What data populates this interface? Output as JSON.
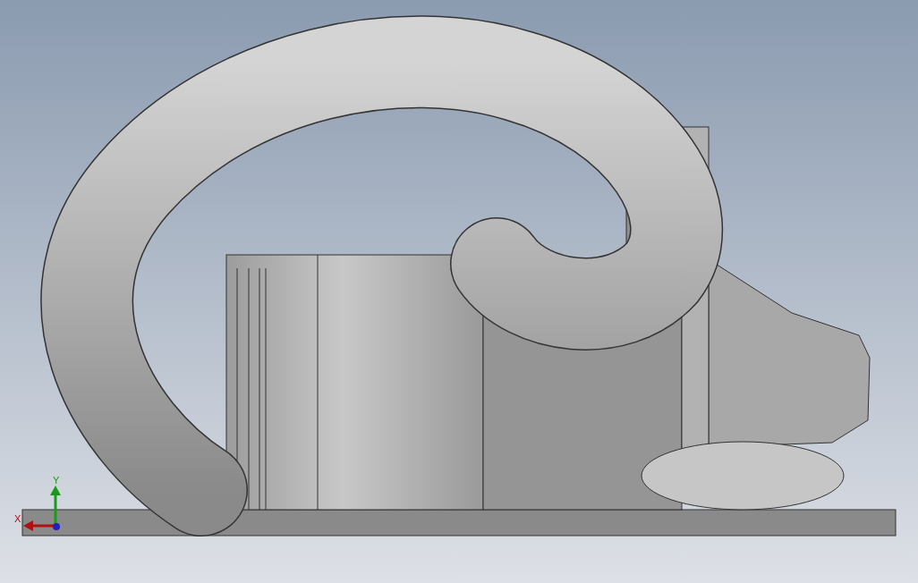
{
  "viewport": {
    "axis_labels": [
      {
        "kind": "x",
        "text": "X"
      },
      {
        "kind": "y",
        "text": "Y"
      }
    ]
  }
}
